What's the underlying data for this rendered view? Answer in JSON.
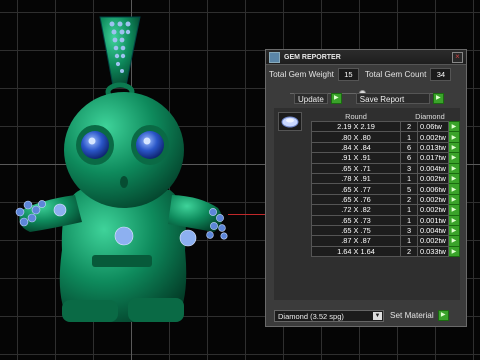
{
  "panel": {
    "title": "GEM REPORTER",
    "close_glyph": "×",
    "total_weight_label": "Total Gem Weight",
    "total_weight_value": "15",
    "total_count_label": "Total Gem Count",
    "total_count_value": "34",
    "slider_level_percent": 48,
    "update_label": "Update",
    "save_report_label": "Save Report",
    "table": {
      "col_size": "Round",
      "col_material": "Diamond",
      "rows": [
        {
          "size": "2.19 X 2.19",
          "count": "2",
          "weight": "0.06tw"
        },
        {
          "size": ".80 X .80",
          "count": "1",
          "weight": "0.002tw"
        },
        {
          "size": ".84 X .84",
          "count": "6",
          "weight": "0.013tw"
        },
        {
          "size": ".91 X .91",
          "count": "6",
          "weight": "0.017tw"
        },
        {
          "size": ".65 X .71",
          "count": "3",
          "weight": "0.004tw"
        },
        {
          "size": ".78 X .91",
          "count": "1",
          "weight": "0.002tw"
        },
        {
          "size": ".65 X .77",
          "count": "5",
          "weight": "0.006tw"
        },
        {
          "size": ".65 X .76",
          "count": "2",
          "weight": "0.002tw"
        },
        {
          "size": ".72 X .82",
          "count": "1",
          "weight": "0.002tw"
        },
        {
          "size": ".65 X .73",
          "count": "1",
          "weight": "0.001tw"
        },
        {
          "size": ".65 X .75",
          "count": "3",
          "weight": "0.004tw"
        },
        {
          "size": ".87 X .87",
          "count": "1",
          "weight": "0.002tw"
        },
        {
          "size": "1.64 X 1.64",
          "count": "2",
          "weight": "0.033tw"
        }
      ]
    },
    "material_select": "Diamond    (3.52 spg)",
    "set_material_label": "Set Material",
    "go_glyph": "▶",
    "dropdown_glyph": "▼"
  },
  "colors": {
    "model_green": "#0f8a5c",
    "gem_blue": "#2a56c8",
    "button_green": "#3aa32a"
  }
}
